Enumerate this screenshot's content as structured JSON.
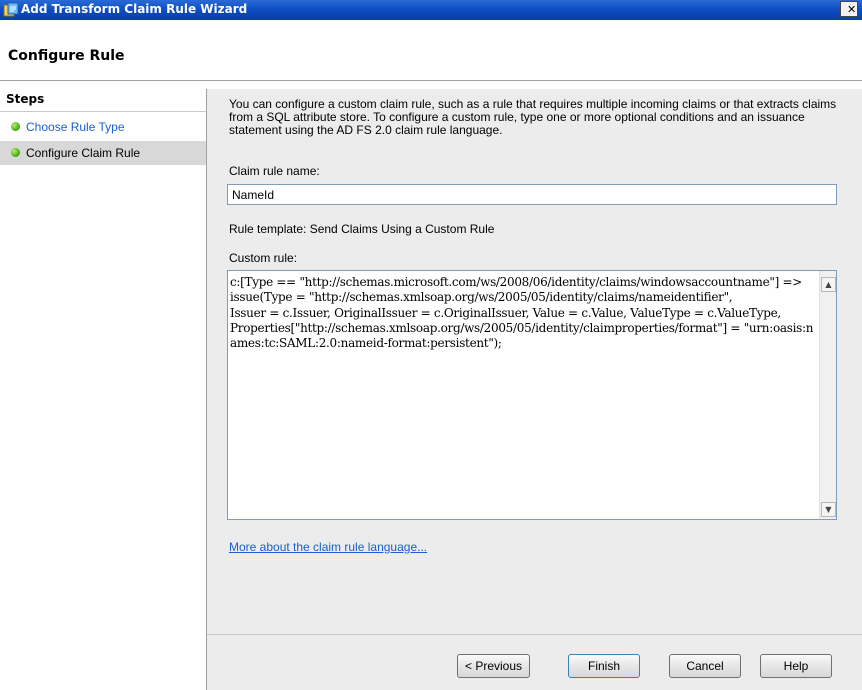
{
  "window": {
    "title": "Add Transform Claim Rule Wizard",
    "close_glyph": "✕",
    "icon": "wizard-icon"
  },
  "header": {
    "title": "Configure Rule"
  },
  "steps": {
    "title": "Steps",
    "items": [
      {
        "label": "Choose Rule Type",
        "state": "link"
      },
      {
        "label": "Configure Claim Rule",
        "state": "current"
      }
    ]
  },
  "main": {
    "description": "You can configure a custom claim rule, such as a rule that requires multiple incoming claims or that extracts claims from a SQL attribute store. To configure a custom rule, type one or more optional conditions and an issuance statement using the AD FS 2.0 claim rule language.",
    "rule_name_label": "Claim rule name:",
    "rule_name_value": "NameId",
    "template_label": "Rule template: Send Claims Using a Custom Rule",
    "custom_rule_label": "Custom rule:",
    "custom_rule_text": "c:[Type == \"http://schemas.microsoft.com/ws/2008/06/identity/claims/windowsaccountname\"] =>\nissue(Type = \"http://schemas.xmlsoap.org/ws/2005/05/identity/claims/nameidentifier\",\nIssuer = c.Issuer, OriginalIssuer = c.OriginalIssuer, Value = c.Value, ValueType = c.ValueType,\nProperties[\"http://schemas.xmlsoap.org/ws/2005/05/identity/claimproperties/format\"] = \"urn:oasis:names:tc:SAML:2.0:nameid-format:persistent\");",
    "learn_more_link": "More about the claim rule language..."
  },
  "buttons": {
    "previous": "< Previous",
    "finish": "Finish",
    "cancel": "Cancel",
    "help": "Help"
  },
  "colors": {
    "title_bar": "#0d4cc1",
    "link": "#1a5fcf",
    "status_ok": "#4cae1c",
    "content_bg": "#ececec",
    "selected_step": "#d8d8d8"
  }
}
